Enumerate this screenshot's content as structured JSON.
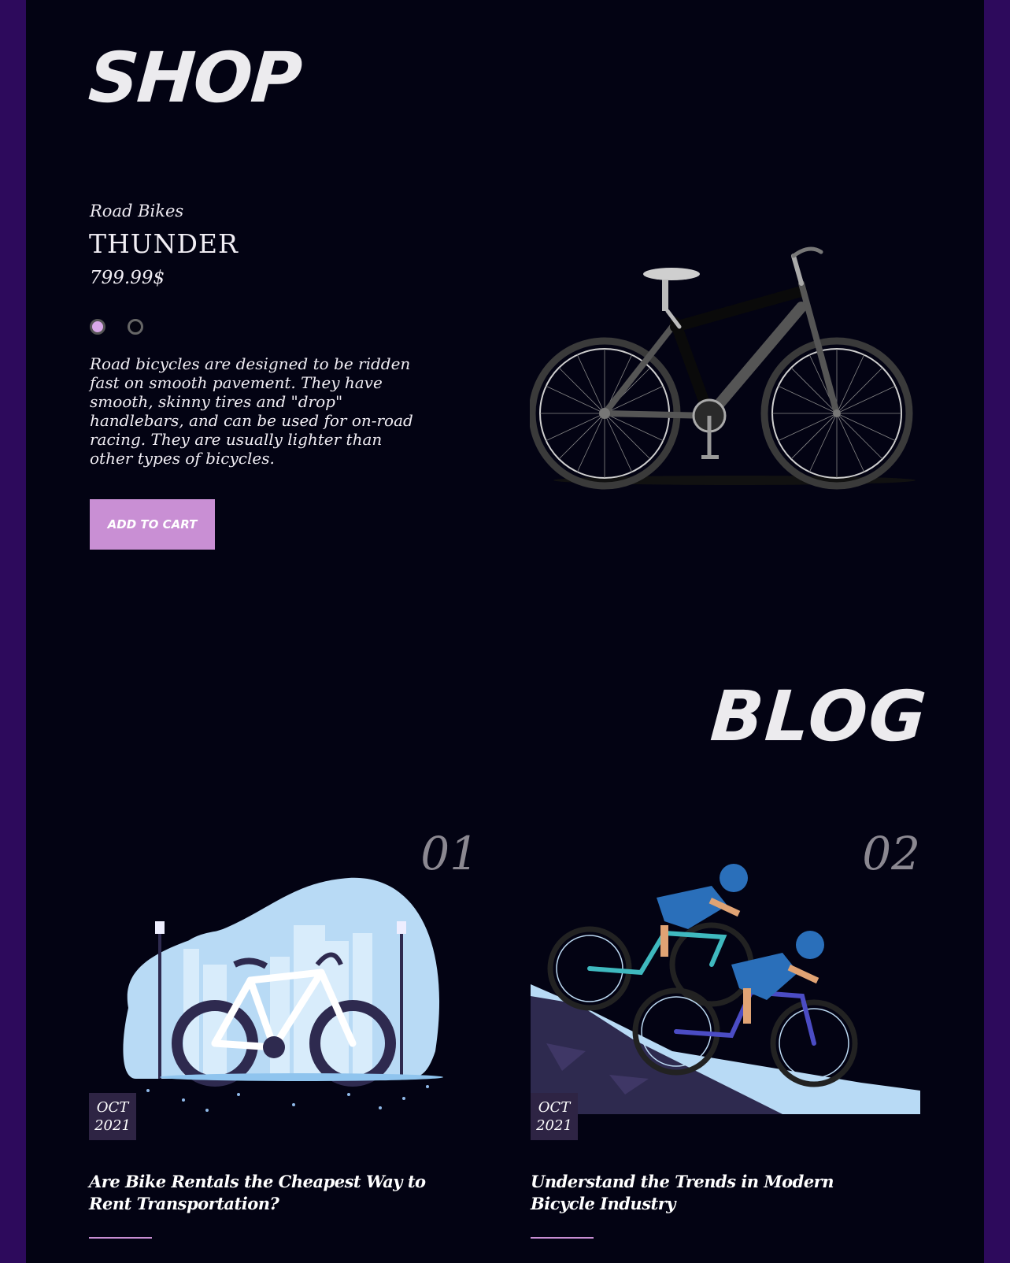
{
  "shop": {
    "title": "SHOP",
    "product": {
      "category": "Road Bikes",
      "name": "THUNDER",
      "price": "799.99$",
      "color_options": [
        "#d8a8e8",
        "#050510"
      ],
      "description": "Road bicycles are designed to be ridden fast on smooth pavement. They have smooth, skinny tires and \"drop\" handlebars, and can be used for on-road racing. They are usually lighter than other types of bicycles.",
      "add_to_cart_label": "ADD TO CART"
    }
  },
  "blog": {
    "title": "BLOG",
    "posts": [
      {
        "number": "01",
        "month": "OCT",
        "year": "2021",
        "title": "Are Bike Rentals the Cheapest Way to Rent Transportation?"
      },
      {
        "number": "02",
        "month": "OCT",
        "year": "2021",
        "title": "Understand the Trends in Modern Bicycle Industry"
      }
    ]
  },
  "colors": {
    "background": "#030313",
    "accent": "#c98fd4",
    "side_bar": "#2d0a5c"
  }
}
